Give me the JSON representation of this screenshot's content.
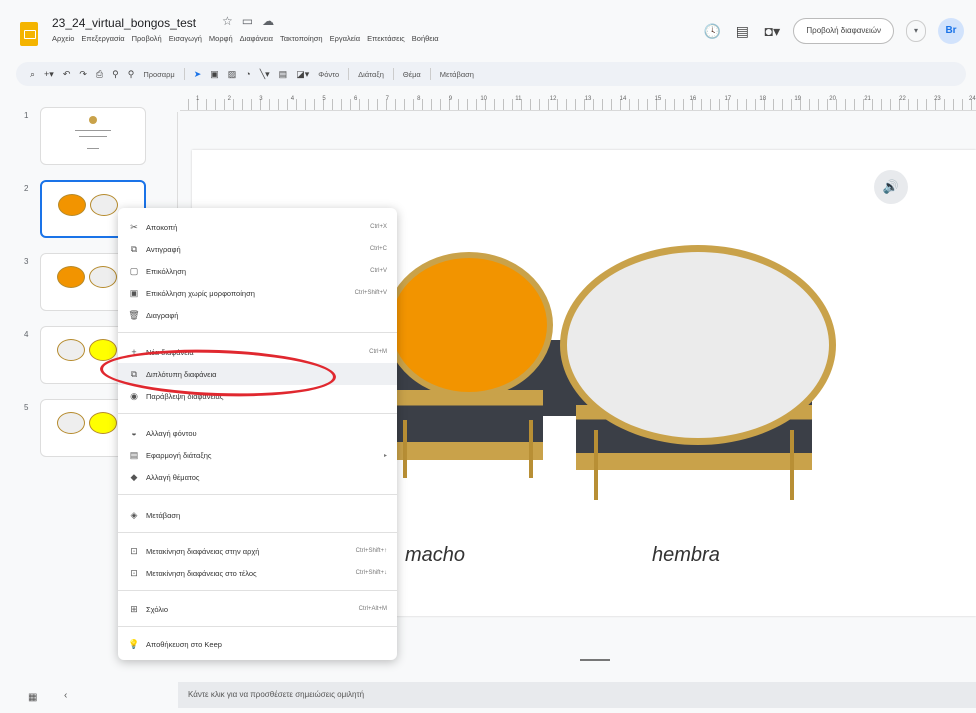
{
  "document": {
    "title": "23_24_virtual_bongos_test"
  },
  "menubar": [
    "Αρχείο",
    "Επεξεργασία",
    "Προβολή",
    "Εισαγωγή",
    "Μορφή",
    "Διαφάνεια",
    "Τακτοποίηση",
    "Εργαλεία",
    "Επεκτάσεις",
    "Βοήθεια"
  ],
  "header": {
    "present_label": "Προβολή διαφανειών",
    "avatar_initials": "Br"
  },
  "toolbar": {
    "zoom": "Προσαρμ",
    "background": "Φόντο",
    "layout": "Διάταξη",
    "theme": "Θέμα",
    "transition": "Μετάβαση"
  },
  "ruler": [
    "1",
    "2",
    "3",
    "4",
    "5",
    "6",
    "7",
    "8",
    "9",
    "10",
    "11",
    "12",
    "13",
    "14",
    "15",
    "16",
    "17",
    "18",
    "19",
    "20",
    "21",
    "22",
    "23",
    "24"
  ],
  "filmstrip": [
    {
      "number": "1"
    },
    {
      "number": "2"
    },
    {
      "number": "3"
    },
    {
      "number": "4"
    },
    {
      "number": "5"
    }
  ],
  "slide": {
    "left_label": "macho",
    "right_label": "hembra"
  },
  "context_menu": {
    "cut": {
      "label": "Αποκοπή",
      "shortcut": "Ctrl+X"
    },
    "copy": {
      "label": "Αντιγραφή",
      "shortcut": "Ctrl+C"
    },
    "paste": {
      "label": "Επικόλληση",
      "shortcut": "Ctrl+V"
    },
    "paste_plain": {
      "label": "Επικόλληση χωρίς μορφοποίηση",
      "shortcut": "Ctrl+Shift+V"
    },
    "delete": {
      "label": "Διαγραφή"
    },
    "new_slide": {
      "label": "Νέα διαφάνεια",
      "shortcut": "Ctrl+M"
    },
    "duplicate_slide": {
      "label": "Διπλότυπη διαφάνεια"
    },
    "skip_slide": {
      "label": "Παράβλεψη διαφάνειας"
    },
    "change_background": {
      "label": "Αλλαγή φόντου"
    },
    "apply_layout": {
      "label": "Εφαρμογή διάταξης"
    },
    "change_theme": {
      "label": "Αλλαγή θέματος"
    },
    "transition": {
      "label": "Μετάβαση"
    },
    "move_to_start": {
      "label": "Μετακίνηση διαφάνειας στην αρχή",
      "shortcut": "Ctrl+Shift+↑"
    },
    "move_to_end": {
      "label": "Μετακίνηση διαφάνειας στο τέλος",
      "shortcut": "Ctrl+Shift+↓"
    },
    "comment": {
      "label": "Σχόλιο",
      "shortcut": "Ctrl+Alt+M"
    },
    "save_to_keep": {
      "label": "Αποθήκευση στο Keep"
    }
  },
  "notes": {
    "placeholder": "Κάντε κλικ για να προσθέσετε σημειώσεις ομιλητή"
  },
  "colors": {
    "accent": "#1a73e8",
    "orange_drum": "#f29400",
    "yellow_drum": "#ffff00",
    "highlight_ellipse": "#e0282f",
    "gold": "#c9a24a"
  }
}
